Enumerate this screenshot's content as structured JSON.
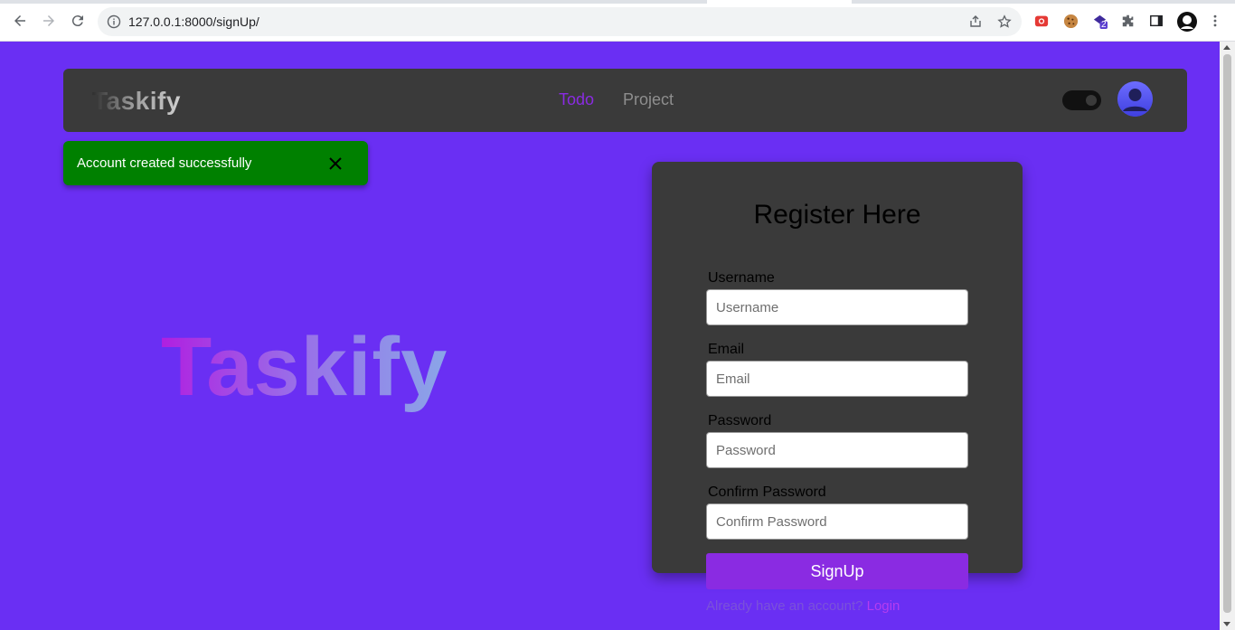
{
  "browser": {
    "url": "127.0.0.1:8000/signUp/",
    "extension_badge": "2"
  },
  "navbar": {
    "brand": "Taskify",
    "links": [
      {
        "label": "Todo",
        "active": true
      },
      {
        "label": "Project",
        "active": false
      }
    ],
    "theme_toggle_on": true
  },
  "toast": {
    "message": "Account created successfully",
    "color": "#008000"
  },
  "hero": {
    "title": "Taskify"
  },
  "form": {
    "heading": "Register Here",
    "fields": [
      {
        "label": "Username",
        "placeholder": "Username",
        "value": ""
      },
      {
        "label": "Email",
        "placeholder": "Email",
        "value": ""
      },
      {
        "label": "Password",
        "placeholder": "Password",
        "value": ""
      },
      {
        "label": "Confirm Password",
        "placeholder": "Confirm Password",
        "value": ""
      }
    ],
    "submit_label": "SignUp",
    "login_prompt": "Already have an account?",
    "login_link": "Login"
  },
  "colors": {
    "page_background": "#6a2ff3",
    "accent": "#8a2be2",
    "panel": "#3a3a3a"
  }
}
